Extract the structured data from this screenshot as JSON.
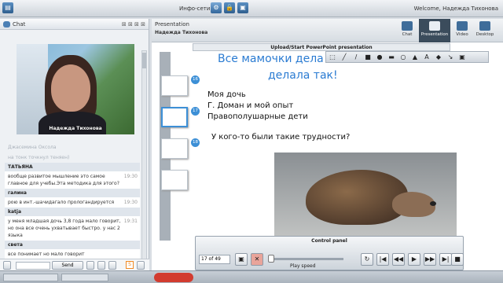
{
  "app": {
    "title": "Инфо-сети",
    "welcome": "Welcome, Надежда Тихонова"
  },
  "chat": {
    "header": "Chat",
    "video_name": "Надежда Тихонова",
    "messages": [
      {
        "kind": "faded",
        "text": "Джасемина Оксола"
      },
      {
        "kind": "faded",
        "text": "на тонк точкнул теняен)"
      },
      {
        "kind": "name",
        "text": "ТАТЬЯНА"
      },
      {
        "kind": "text",
        "text": "вообще развитое мышление это самое главное для учебы.Эта методика для этого?",
        "time": "19:30"
      },
      {
        "kind": "name",
        "text": "галина"
      },
      {
        "kind": "text",
        "text": "рою в инт.-шачидагало прологандируется",
        "time": "19:30"
      },
      {
        "kind": "name",
        "text": "katja"
      },
      {
        "kind": "text",
        "text": "у меня младшая дочь 3,8 года мало говорит, но она все очень ухватывает быстро. у нас 2 языка",
        "time": "19:31"
      },
      {
        "kind": "name",
        "text": "света"
      },
      {
        "kind": "text",
        "text": "все понимает но мало говорит",
        "time": ""
      }
    ],
    "send_label": "Send",
    "badge": "S"
  },
  "presentation": {
    "title": "Presentation",
    "presenter": "Надежда Тихонова",
    "tabs": [
      "Chat",
      "Presentation",
      "Video",
      "Desktop"
    ],
    "active_tab": "Presentation",
    "upload_label": "Upload/Start PowerPoint presentation",
    "thumb_numbers": [
      "16",
      "17",
      "18"
    ],
    "slide": {
      "title_line1": "Все мамочки дела",
      "title_line2": "делала так!",
      "bullets": [
        "Моя дочь",
        "Г. Доман и мой опыт",
        "Правополушарные дети"
      ],
      "question": "У кого-то были такие трудности?"
    },
    "control": {
      "title": "Control panel",
      "page": "17 of 49",
      "speed_label": "Play speed"
    }
  }
}
